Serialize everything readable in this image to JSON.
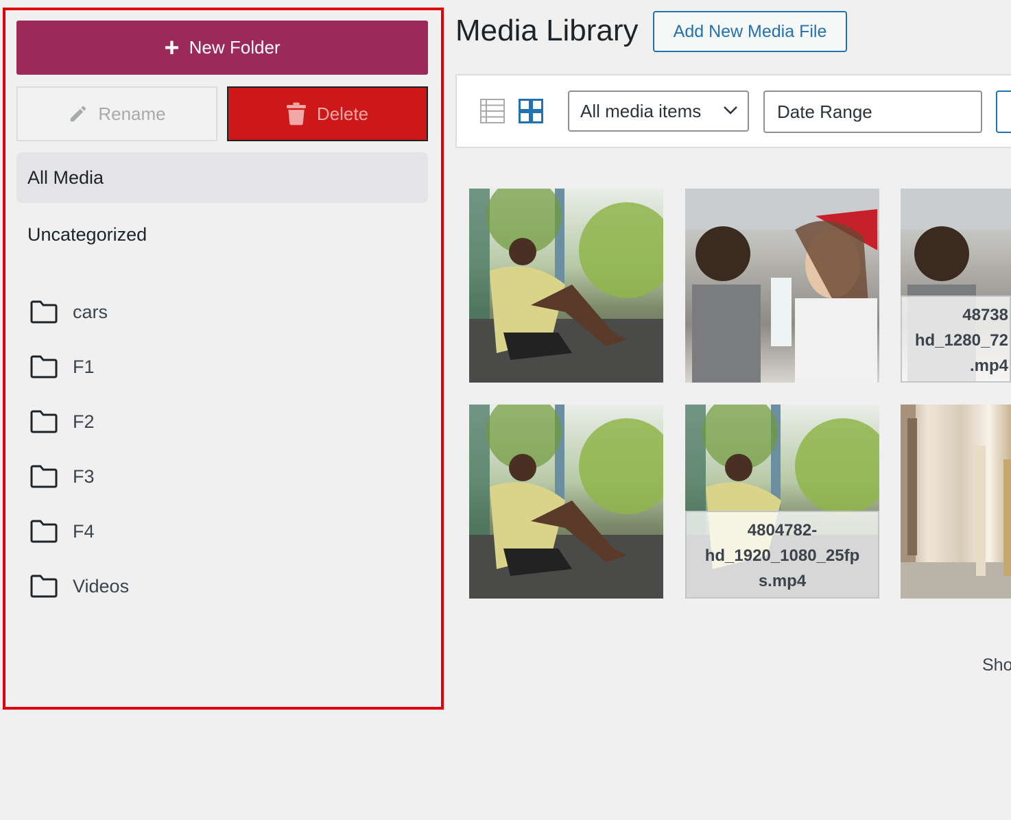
{
  "sidebar": {
    "new_folder_label": "New Folder",
    "rename_label": "Rename",
    "delete_label": "Delete",
    "all_media_label": "All Media",
    "uncategorized_label": "Uncategorized",
    "folders": [
      "cars",
      "F1",
      "F2",
      "F3",
      "F4",
      "Videos"
    ]
  },
  "header": {
    "title": "Media Library",
    "add_new_label": "Add New Media File"
  },
  "toolbar": {
    "filter_value": "All media items",
    "date_range_label": "Date Range"
  },
  "media": {
    "captions": [
      "48738",
      "hd_1280_72",
      ".mp4",
      "4804782-",
      "hd_1920_1080_25fp",
      "s.mp4"
    ]
  },
  "footer": {
    "partial_text": "Sho"
  },
  "colors": {
    "new_folder_bg": "#9b2a5b",
    "delete_bg": "#cc1818",
    "highlight_border": "#e3000b",
    "link_blue": "#2271b1"
  }
}
